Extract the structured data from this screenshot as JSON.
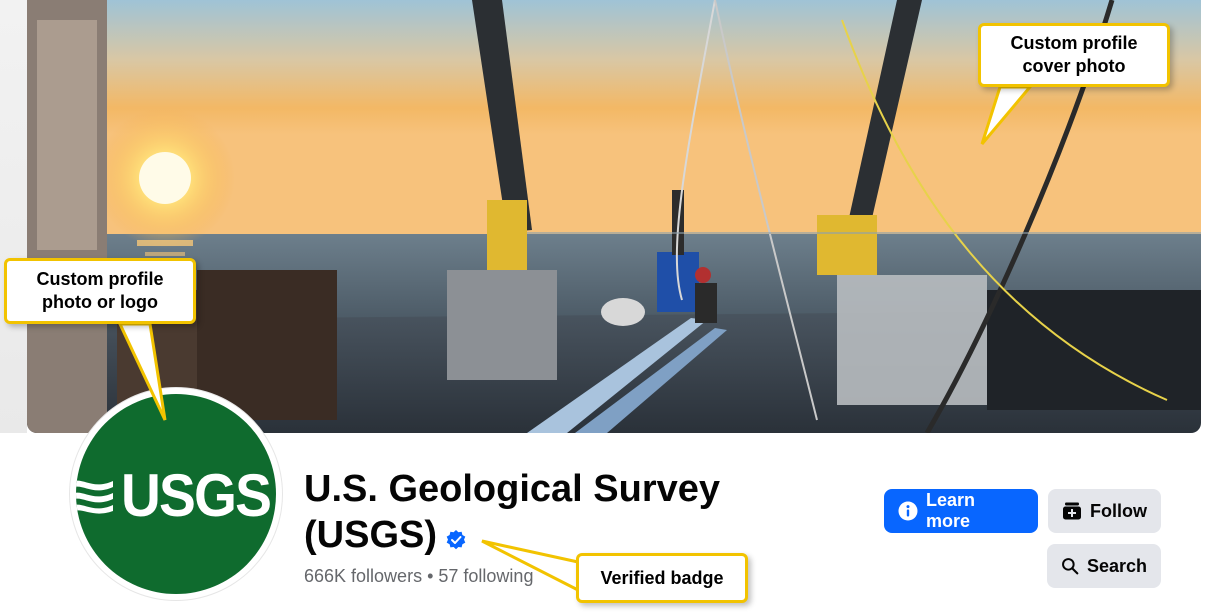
{
  "page": {
    "title": "U.S. Geological Survey (USGS)",
    "followers": "666K followers",
    "separator": " • ",
    "following": "57 following",
    "verified_icon": "verified-badge-icon"
  },
  "logo": {
    "text": "USGS",
    "background_color": "#0f6b2e"
  },
  "actions": {
    "learn_more": "Learn more",
    "follow": "Follow",
    "search": "Search"
  },
  "icons": {
    "learn_more": "info-icon",
    "follow": "follow-plus-icon",
    "search": "search-icon"
  },
  "colors": {
    "primary_button": "#0866ff",
    "secondary_button": "#e4e6eb",
    "callout_border": "#f2c300",
    "verified": "#0866ff"
  },
  "annotations": {
    "cover": "Custom profile\ncover photo",
    "logo": "Custom profile\nphoto or logo",
    "verified": "Verified badge"
  }
}
